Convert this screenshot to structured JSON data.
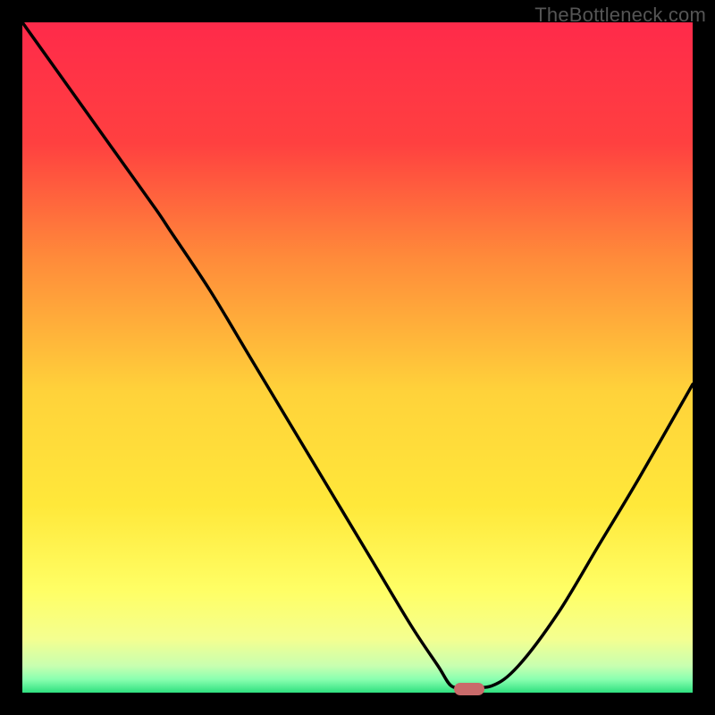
{
  "watermark": "TheBottleneck.com",
  "marker": {
    "color": "#c96a6a",
    "x_fraction": 0.667,
    "y_fraction": 0.995
  },
  "chart_data": {
    "type": "line",
    "title": "",
    "xlabel": "",
    "ylabel": "",
    "xlim": [
      0,
      1
    ],
    "ylim": [
      0,
      1
    ],
    "background_gradient": {
      "top": "#ff2a4a",
      "mid_upper": "#ff8a3a",
      "mid": "#ffd23a",
      "mid_lower": "#ffff66",
      "lower": "#e8ff99",
      "bottom": "#2fe07f"
    },
    "series": [
      {
        "name": "bottleneck-curve",
        "color": "#000000",
        "x": [
          0.0,
          0.05,
          0.1,
          0.15,
          0.2,
          0.22,
          0.28,
          0.34,
          0.4,
          0.46,
          0.52,
          0.58,
          0.62,
          0.64,
          0.66,
          0.7,
          0.74,
          0.8,
          0.86,
          0.92,
          1.0
        ],
        "y": [
          1.0,
          0.93,
          0.86,
          0.79,
          0.72,
          0.69,
          0.6,
          0.5,
          0.4,
          0.3,
          0.2,
          0.1,
          0.04,
          0.01,
          0.01,
          0.01,
          0.04,
          0.12,
          0.22,
          0.32,
          0.46
        ]
      }
    ],
    "marker_point": {
      "x": 0.667,
      "y": 0.005
    }
  }
}
